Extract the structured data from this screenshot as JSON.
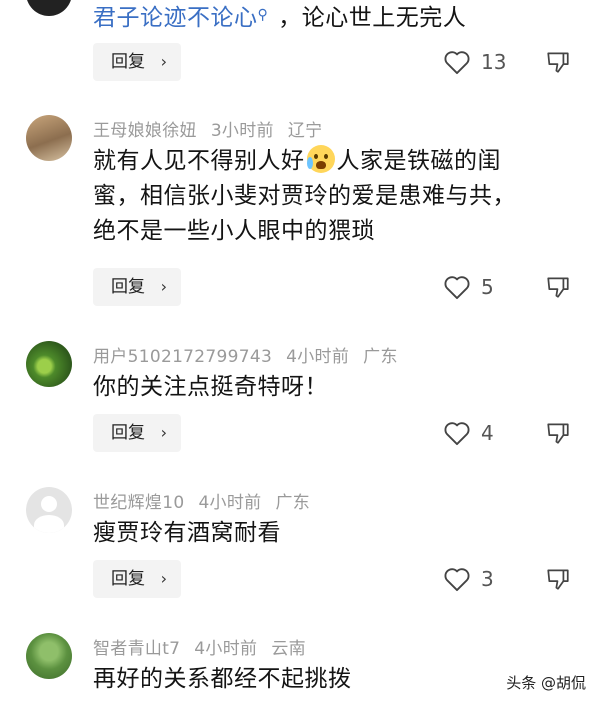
{
  "top_comment": {
    "text": "君子论迹不论心",
    "text_suffix": "，论心世上无完人",
    "reply_label": "回复",
    "like_count": "13"
  },
  "comments": [
    {
      "username": "王母娘娘徐妞",
      "time": "3小时前",
      "location": "辽宁",
      "lines": [
        "就有人见不得别人好",
        "人家是铁磁的闺",
        "蜜，相信张小斐对贾玲的爱是患难与共，",
        "绝不是一些小人眼中的猥琐"
      ],
      "reply_label": "回复",
      "like_count": "5"
    },
    {
      "username": "用户5102172799743",
      "time": "4小时前",
      "location": "广东",
      "text": "你的关注点挺奇特呀！",
      "reply_label": "回复",
      "like_count": "4"
    },
    {
      "username": "世纪辉煌10",
      "time": "4小时前",
      "location": "广东",
      "text": "瘦贾玲有酒窝耐看",
      "reply_label": "回复",
      "like_count": "3"
    },
    {
      "username": "智者青山t7",
      "time": "4小时前",
      "location": "云南",
      "text": "再好的关系都经不起挑拨"
    }
  ],
  "watermark": "头条 @胡侃",
  "colors": {
    "link": "#3a6fc4",
    "meta": "#9a9a9a",
    "button_bg": "#f3f3f3"
  }
}
